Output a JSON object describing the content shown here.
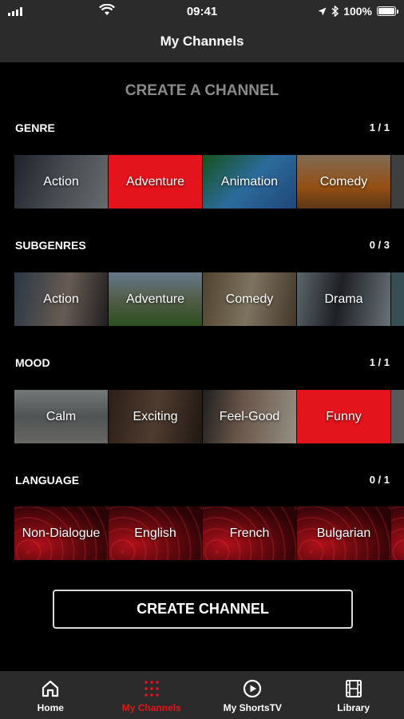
{
  "status": {
    "time": "09:41",
    "battery": "100%"
  },
  "header": {
    "title": "My Channels"
  },
  "section_title": "CREATE A CHANNEL",
  "genre": {
    "label": "GENRE",
    "count": "1 / 1",
    "tiles": [
      {
        "label": "Action",
        "selected": false,
        "bg": "linear-gradient(110deg,#2a3038 0%,#5a6068 45%,#8a8f90 100%)"
      },
      {
        "label": "Adventure",
        "selected": true,
        "bg": "#e3141b"
      },
      {
        "label": "Animation",
        "selected": false,
        "bg": "linear-gradient(135deg,#1f6e2a 0%,#3a8fd0 50%,#2a5fa0 100%)"
      },
      {
        "label": "Comedy",
        "selected": false,
        "bg": "linear-gradient(180deg,#a89070 0%,#c76a1a 60%,#7a4a20 100%)"
      },
      {
        "label": "",
        "selected": false,
        "bg": "#555"
      }
    ]
  },
  "subgenres": {
    "label": "SUBGENRES",
    "count": "0 / 3",
    "tiles": [
      {
        "label": "Action",
        "selected": false,
        "bg": "linear-gradient(100deg,#3a4a5a 0%,#8a7a70 55%,#2a2a2a 100%)"
      },
      {
        "label": "Adventure",
        "selected": false,
        "bg": "linear-gradient(180deg,#8aa0b8 0%,#6a7a5a 55%,#3a6a2a 100%)"
      },
      {
        "label": "Comedy",
        "selected": false,
        "bg": "linear-gradient(100deg,#6a5a40 0%,#a89a80 50%,#5a4a3a 100%)"
      },
      {
        "label": "Drama",
        "selected": false,
        "bg": "linear-gradient(100deg,#7a8a90 0%,#2a2a30 45%,#8a9aa0 100%)"
      },
      {
        "label": "",
        "selected": false,
        "bg": "#4a6a70"
      }
    ]
  },
  "mood": {
    "label": "MOOD",
    "count": "1 / 1",
    "tiles": [
      {
        "label": "Calm",
        "selected": false,
        "bg": "linear-gradient(180deg,#9aa0a0 0%,#6a7070 50%,#8a8a85 100%)"
      },
      {
        "label": "Exciting",
        "selected": false,
        "bg": "linear-gradient(100deg,#3a2a20 0%,#6a5040 50%,#2a2018 100%)"
      },
      {
        "label": "Feel-Good",
        "selected": false,
        "bg": "linear-gradient(100deg,#2a2a2a 0%,#8a7060 40%,#c8c0b0 100%)"
      },
      {
        "label": "Funny",
        "selected": true,
        "bg": "#e3141b"
      },
      {
        "label": "",
        "selected": false,
        "bg": "#777"
      }
    ]
  },
  "language": {
    "label": "LANGUAGE",
    "count": "0 / 1",
    "tiles": [
      {
        "label": "Non-Dialogue"
      },
      {
        "label": "English"
      },
      {
        "label": "French"
      },
      {
        "label": "Bulgarian"
      },
      {
        "label": ""
      }
    ]
  },
  "create_button": "CREATE CHANNEL",
  "tabs": [
    {
      "label": "Home",
      "icon": "home-icon",
      "active": false
    },
    {
      "label": "My Channels",
      "icon": "grid-icon",
      "active": true
    },
    {
      "label": "My ShortsTV",
      "icon": "play-circle-icon",
      "active": false
    },
    {
      "label": "Library",
      "icon": "film-icon",
      "active": false
    }
  ],
  "colors": {
    "accent": "#e3141b",
    "bar": "#2b2b2b",
    "muted": "#8a8a8a"
  }
}
